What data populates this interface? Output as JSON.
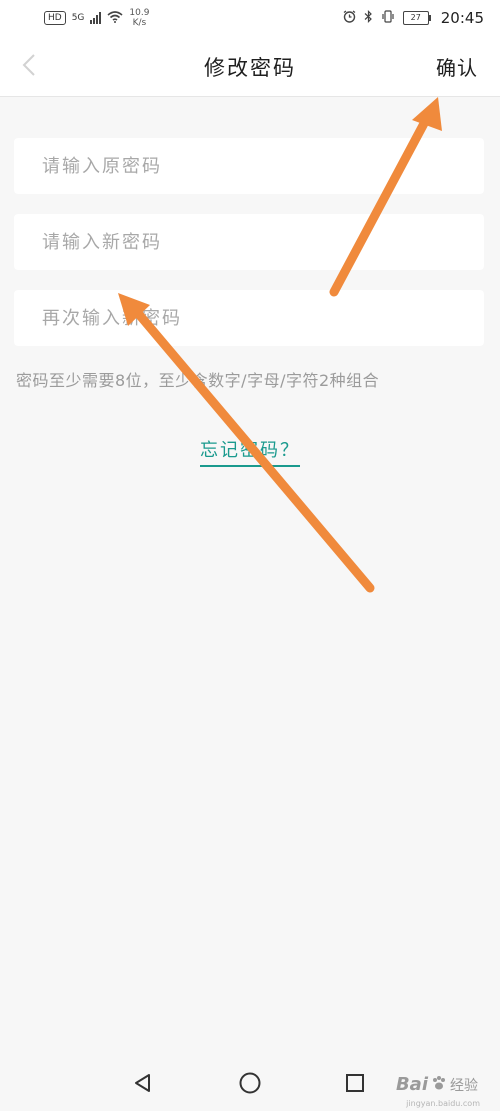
{
  "status_bar": {
    "hd": "HD",
    "network": "5G",
    "speed_value": "10.9",
    "speed_unit": "K/s",
    "battery": "27",
    "time": "20:45"
  },
  "header": {
    "title": "修改密码",
    "confirm_label": "确认"
  },
  "form": {
    "old_password_placeholder": "请输入原密码",
    "new_password_placeholder": "请输入新密码",
    "repeat_password_placeholder": "再次输入新密码",
    "hint": "密码至少需要8位，至少含数字/字母/字符2种组合",
    "forgot_label": "忘记密码？"
  },
  "annotation": {
    "arrow_color": "#f08a3c"
  },
  "watermark": {
    "logo": "Bai",
    "label": "经验",
    "url": "jingyan.baidu.com"
  },
  "colors": {
    "accent": "#1a9a8e",
    "background": "#f7f7f7"
  }
}
